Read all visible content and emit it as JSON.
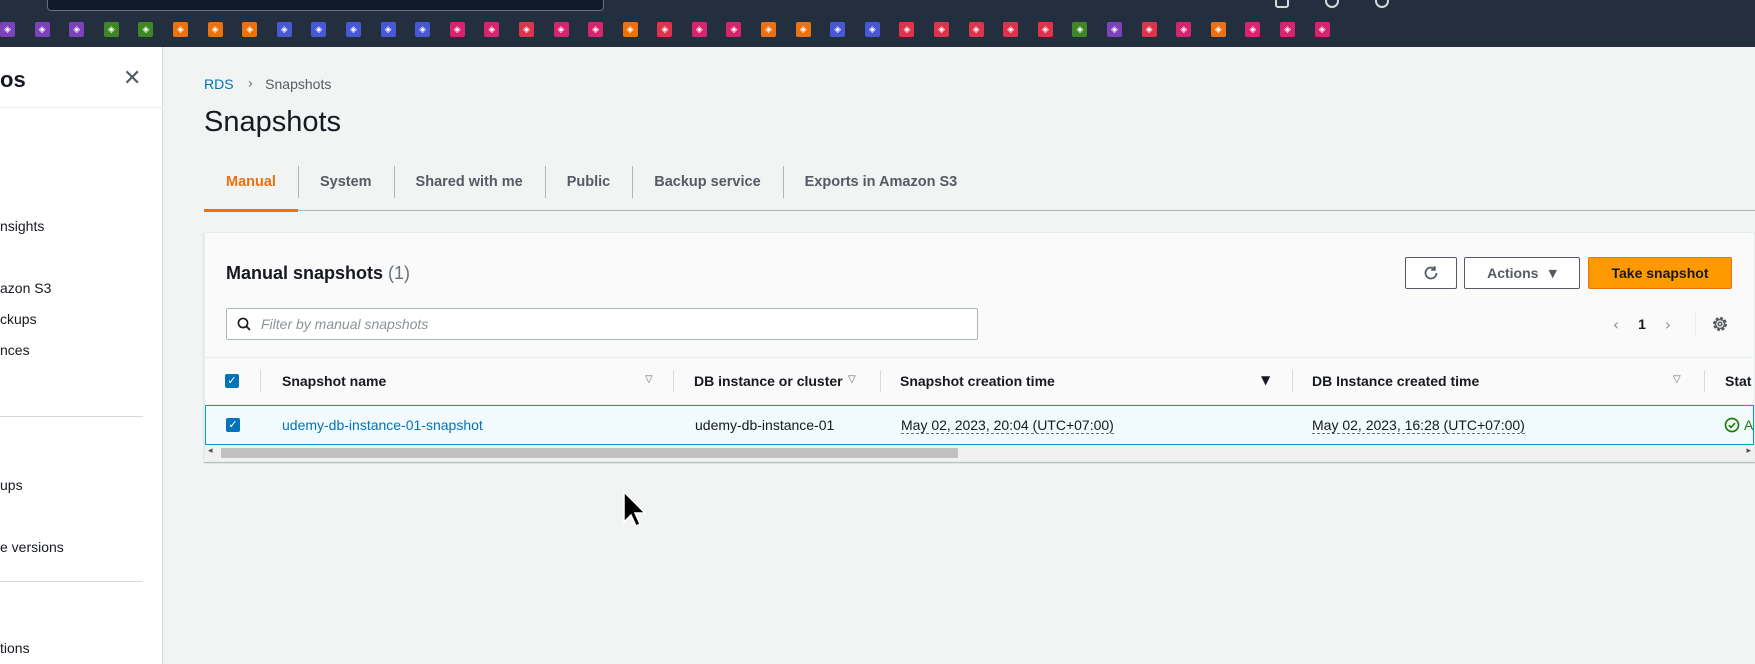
{
  "topbar": {
    "favorite_icons": [
      {
        "color": "#7b42bc"
      },
      {
        "color": "#7b42bc"
      },
      {
        "color": "#7b42bc"
      },
      {
        "color": "#3f8624"
      },
      {
        "color": "#3f8624"
      },
      {
        "color": "#ec7211"
      },
      {
        "color": "#ec7211"
      },
      {
        "color": "#ec7211"
      },
      {
        "color": "#4757d6"
      },
      {
        "color": "#4757d6"
      },
      {
        "color": "#4757d6"
      },
      {
        "color": "#4757d6"
      },
      {
        "color": "#4757d6"
      },
      {
        "color": "#d6246e"
      },
      {
        "color": "#d6246e"
      },
      {
        "color": "#dd344c"
      },
      {
        "color": "#d6246e"
      },
      {
        "color": "#d6246e"
      },
      {
        "color": "#ec7211"
      },
      {
        "color": "#dd344c"
      },
      {
        "color": "#d6246e"
      },
      {
        "color": "#d6246e"
      },
      {
        "color": "#ec7211"
      },
      {
        "color": "#ec7211"
      },
      {
        "color": "#4757d6"
      },
      {
        "color": "#4757d6"
      },
      {
        "color": "#dd344c"
      },
      {
        "color": "#dd344c"
      },
      {
        "color": "#dd344c"
      },
      {
        "color": "#dd344c"
      },
      {
        "color": "#dd344c"
      },
      {
        "color": "#3f8624"
      },
      {
        "color": "#7b42bc"
      },
      {
        "color": "#dd344c"
      },
      {
        "color": "#d6246e"
      },
      {
        "color": "#ec7211"
      },
      {
        "color": "#d6246e"
      },
      {
        "color": "#d6246e"
      },
      {
        "color": "#d6246e"
      }
    ]
  },
  "sidebar": {
    "title": "os",
    "items": [
      {
        "label": "nsights"
      },
      {
        "label": "azon S3"
      },
      {
        "label": "ckups"
      },
      {
        "label": "nces"
      },
      {
        "label": "ups"
      },
      {
        "label": "e versions"
      },
      {
        "label": "tions"
      }
    ]
  },
  "breadcrumb": {
    "root": "RDS",
    "current": "Snapshots"
  },
  "page": {
    "title": "Snapshots"
  },
  "tabs": [
    {
      "label": "Manual",
      "active": true
    },
    {
      "label": "System",
      "active": false
    },
    {
      "label": "Shared with me",
      "active": false
    },
    {
      "label": "Public",
      "active": false
    },
    {
      "label": "Backup service",
      "active": false
    },
    {
      "label": "Exports in Amazon S3",
      "active": false
    }
  ],
  "panel": {
    "title": "Manual snapshots",
    "count": "(1)",
    "actions_label": "Actions",
    "take_snapshot_label": "Take snapshot",
    "filter_placeholder": "Filter by manual snapshots",
    "page_number": "1"
  },
  "table": {
    "columns": [
      {
        "label": "Snapshot name"
      },
      {
        "label": "DB instance or cluster"
      },
      {
        "label": "Snapshot creation time"
      },
      {
        "label": "DB Instance created time"
      },
      {
        "label": "Stat"
      }
    ],
    "rows": [
      {
        "snapshot_name": "udemy-db-instance-01-snapshot",
        "db_instance": "udemy-db-instance-01",
        "snapshot_creation_time": "May 02, 2023, 20:04 (UTC+07:00)",
        "db_instance_created_time": "May 02, 2023, 16:28 (UTC+07:00)",
        "status_partial": "A",
        "status_color": "#1d8102"
      }
    ]
  },
  "colors": {
    "accent": "#ec7211",
    "primary_button": "#ff9900",
    "link": "#0073bb",
    "topbar": "#232f3e"
  }
}
